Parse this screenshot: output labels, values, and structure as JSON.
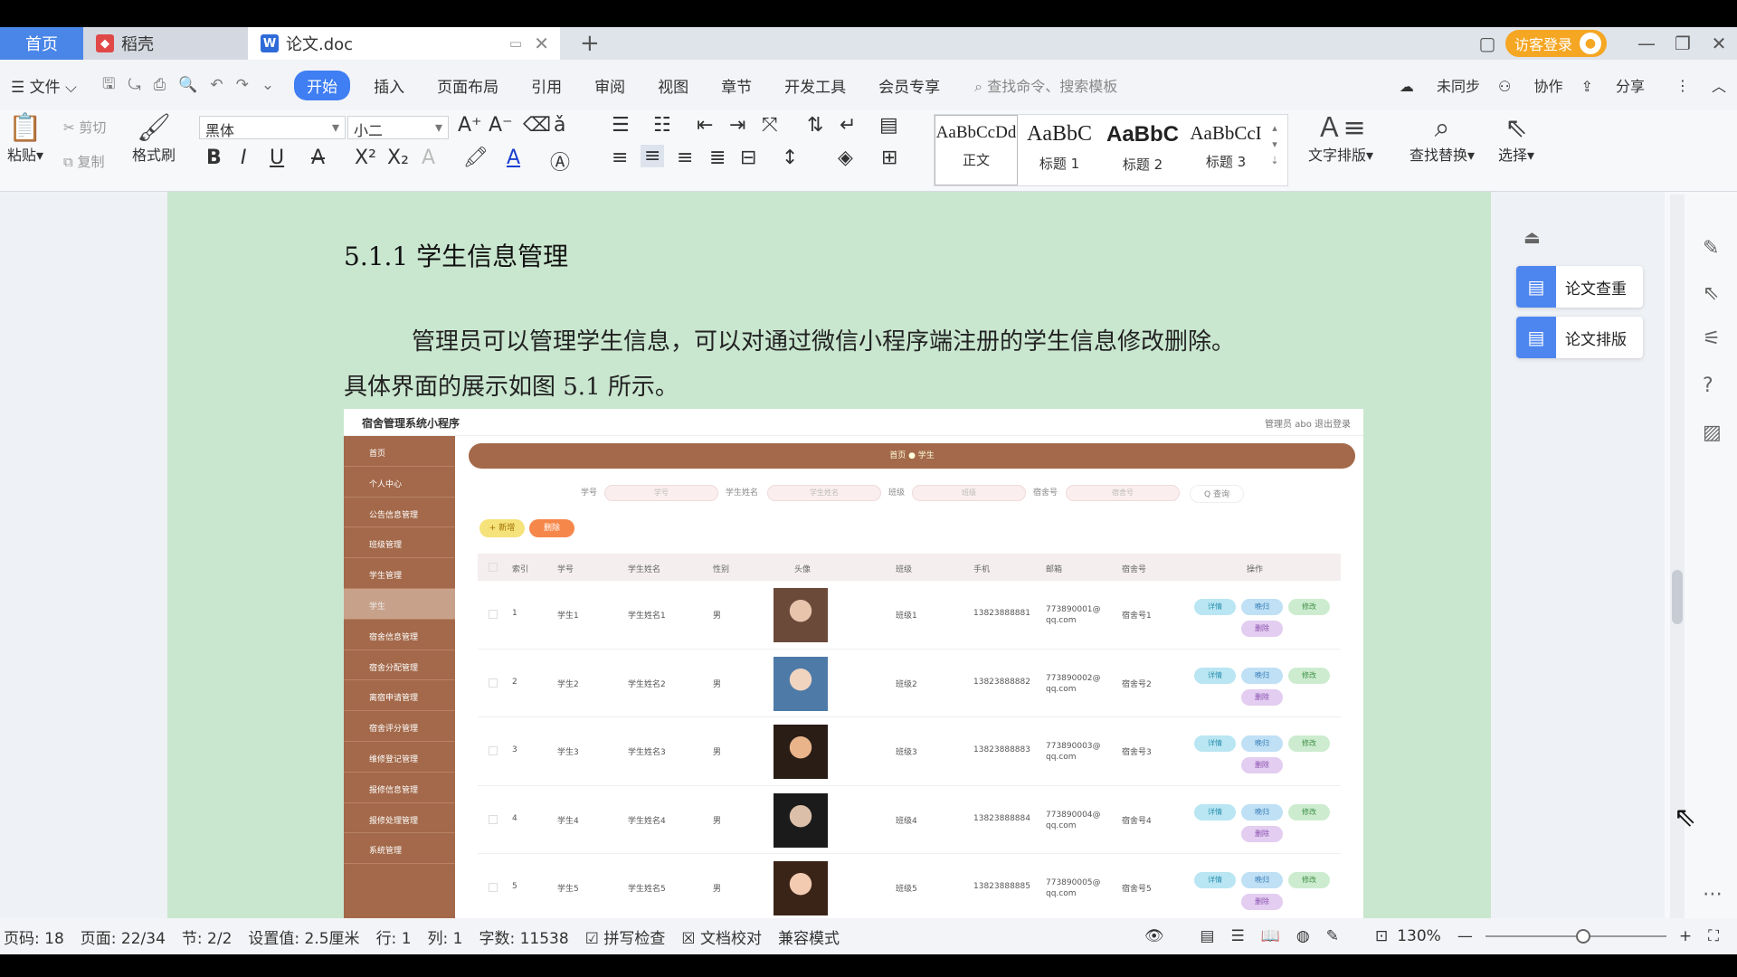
{
  "tabs": {
    "home": "首页",
    "tab1": "稻壳",
    "tab2": "论文.doc"
  },
  "window": {
    "visitor_login": "访客登录"
  },
  "menu": {
    "file": "文件",
    "items": [
      "开始",
      "插入",
      "页面布局",
      "引用",
      "审阅",
      "视图",
      "章节",
      "开发工具",
      "会员专享"
    ],
    "search_placeholder": "查找命令、搜索模板",
    "not_synced": "未同步",
    "collaborate": "协作",
    "share": "分享"
  },
  "ribbon": {
    "paste": "粘贴",
    "cut": "剪切",
    "copy": "复制",
    "format_painter": "格式刷",
    "font": "黑体",
    "font_size": "小二",
    "styles": [
      {
        "sample": "AaBbCcDd",
        "name": "正文"
      },
      {
        "sample": "AaBbC",
        "name": "标题 1"
      },
      {
        "sample": "AaBbC",
        "name": "标题 2"
      },
      {
        "sample": "AaBbCcI",
        "name": "标题 3"
      }
    ],
    "text_layout": "文字排版",
    "find_replace": "查找替换",
    "select": "选择"
  },
  "document": {
    "heading": "5.1.1  学生信息管理",
    "para_line1": "管理员可以管理学生信息，可以对通过微信小程序端注册的学生信息修改删除。",
    "para_line2": "具体界面的展示如图 5.1 所示。"
  },
  "screenshot": {
    "app_title": "宿舍管理系统小程序",
    "top_right": "管理员 abo    退出登录",
    "breadcrumb": "首页 ● 学生",
    "sidebar": [
      "首页",
      "个人中心",
      "公告信息管理",
      "班级管理",
      "学生管理",
      "学生",
      "宿舍信息管理",
      "宿舍分配管理",
      "离宿申请管理",
      "宿舍评分管理",
      "维修登记管理",
      "报修信息管理",
      "报修处理管理",
      "系统管理"
    ],
    "search_labels": [
      "学号",
      "学生姓名",
      "班级",
      "宿舍号"
    ],
    "search_placeholders": [
      "学号",
      "学生姓名",
      "班级",
      "宿舍号"
    ],
    "search_btn": "Q 查询",
    "add_btn": "+ 新增",
    "delete_btn": "删除",
    "columns": [
      "索引",
      "学号",
      "学生姓名",
      "性别",
      "头像",
      "班级",
      "手机",
      "邮箱",
      "宿舍号",
      "操作"
    ],
    "rows": [
      [
        "1",
        "学生1",
        "学生姓名1",
        "男",
        "班级1",
        "13823888881",
        "773890001@qq.com",
        "宿舍号1"
      ],
      [
        "2",
        "学生2",
        "学生姓名2",
        "男",
        "班级2",
        "13823888882",
        "773890002@qq.com",
        "宿舍号2"
      ],
      [
        "3",
        "学生3",
        "学生姓名3",
        "男",
        "班级3",
        "13823888883",
        "773890003@qq.com",
        "宿舍号3"
      ],
      [
        "4",
        "学生4",
        "学生姓名4",
        "男",
        "班级4",
        "13823888884",
        "773890004@qq.com",
        "宿舍号4"
      ],
      [
        "5",
        "学生5",
        "学生姓名5",
        "男",
        "班级5",
        "13823888885",
        "773890005@qq.com",
        "宿舍号5"
      ]
    ],
    "action_labels": [
      "详情",
      "晚归",
      "修改",
      "删除"
    ]
  },
  "right_panel": {
    "check": "论文查重",
    "layout": "论文排版"
  },
  "status": {
    "page_code": "页码: 18",
    "page": "页面: 22/34",
    "section": "节: 2/2",
    "setting": "设置值: 2.5厘米",
    "line": "行: 1",
    "col": "列: 1",
    "words": "字数: 11538",
    "spell": "拼写检查",
    "proof": "文档校对",
    "compat": "兼容模式",
    "zoom": "130%"
  },
  "colors": {
    "accent": "#3f7ef3",
    "page_bg": "#c9e6cf",
    "sidebar_brown": "#a3694a",
    "visitor": "#f5a623"
  }
}
